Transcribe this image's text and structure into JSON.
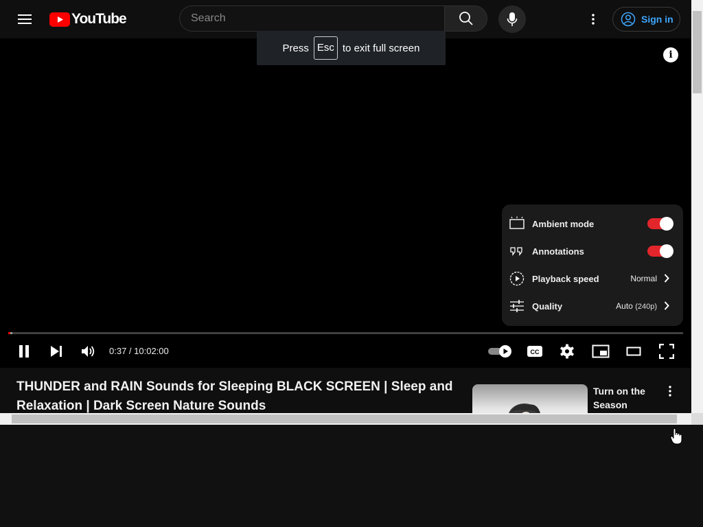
{
  "header": {
    "logo_text": "YouTube",
    "search_placeholder": "Search",
    "sign_in_label": "Sign in"
  },
  "player": {
    "fullscreen_toast": {
      "press": "Press",
      "key": "Esc",
      "rest": "to exit full screen"
    },
    "info_label": "i",
    "current_time": "0:37",
    "duration": "10:02:00",
    "time_display": "0:37 / 10:02:00",
    "progress_fraction": 0.001,
    "settings_menu": {
      "ambient_mode": {
        "label": "Ambient mode",
        "on": true
      },
      "annotations": {
        "label": "Annotations",
        "on": true
      },
      "playback_speed": {
        "label": "Playback speed",
        "value": "Normal"
      },
      "quality": {
        "label": "Quality",
        "value": "Auto",
        "detail": "(240p)"
      }
    },
    "colors": {
      "accent": "#ff0000",
      "toggle_on": "#e2262b",
      "link": "#3ea6ff"
    }
  },
  "video": {
    "title_line1": "THUNDER and RAIN Sounds for Sleeping BLACK SCREEN | Sleep and",
    "title_line2": "Relaxation | Dark Screen Nature Sounds"
  },
  "sidebar_ad": {
    "title_line1": "Turn on the",
    "title_line2": "Season"
  }
}
